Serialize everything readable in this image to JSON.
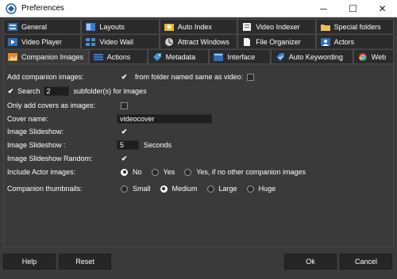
{
  "window": {
    "title": "Preferences",
    "minimize": "─",
    "maximize": "☐",
    "close": "✕"
  },
  "tabs": {
    "row1": [
      {
        "label": "General",
        "icon": "general-icon"
      },
      {
        "label": "Layouts",
        "icon": "layouts-icon"
      },
      {
        "label": "Auto Index",
        "icon": "auto-index-icon"
      },
      {
        "label": "Video Indexer",
        "icon": "video-indexer-icon"
      },
      {
        "label": "Special folders",
        "icon": "folder-icon"
      }
    ],
    "row2": [
      {
        "label": "Video Player",
        "icon": "video-player-icon"
      },
      {
        "label": "Video Wall",
        "icon": "video-wall-icon"
      },
      {
        "label": "Attract Windows",
        "icon": "attract-windows-icon"
      },
      {
        "label": "File Organizer",
        "icon": "file-organizer-icon"
      },
      {
        "label": "Actors",
        "icon": "actors-icon"
      }
    ],
    "row3": [
      {
        "label": "Companion Images",
        "icon": "companion-images-icon"
      },
      {
        "label": "Actions",
        "icon": "actions-icon"
      },
      {
        "label": "Metadata",
        "icon": "metadata-icon"
      },
      {
        "label": "Interface",
        "icon": "interface-icon"
      },
      {
        "label": "Auto Keywording",
        "icon": "auto-keywording-icon"
      },
      {
        "label": "Web",
        "icon": "web-icon"
      }
    ]
  },
  "settings": {
    "add_companion_images": {
      "label": "Add companion images:",
      "checked": true
    },
    "from_folder_same_name": {
      "label": "from folder named same as video:",
      "checked": false
    },
    "search": {
      "label": "Search",
      "checked": true,
      "value": "2",
      "suffix": "subfolder(s) for images"
    },
    "only_covers": {
      "label": "Only add covers as images:",
      "checked": false
    },
    "cover_name": {
      "label": "Cover name:",
      "value": "videocover"
    },
    "slideshow": {
      "label": "Image Slideshow:",
      "checked": true
    },
    "slideshow_interval": {
      "label": "Image Slideshow :",
      "value": "5",
      "unit": "Seconds"
    },
    "slideshow_random": {
      "label": "Image Slideshow Random:",
      "checked": true
    },
    "include_actor": {
      "label": "Include Actor images:",
      "options": [
        "No",
        "Yes",
        "Yes, if no other companion images"
      ],
      "selected": "No"
    },
    "thumbnails": {
      "label": "Companion thumbnails:",
      "options": [
        "Small",
        "Medium",
        "Large",
        "Huge"
      ],
      "selected": "Medium"
    }
  },
  "buttons": {
    "help": "Help",
    "reset": "Reset",
    "ok": "Ok",
    "cancel": "Cancel"
  },
  "colors": {
    "background": "#3a3a3a",
    "tab_bg": "#2b2b2b",
    "field_bg": "#1e1e1e",
    "titlebar": "#ffffff"
  }
}
